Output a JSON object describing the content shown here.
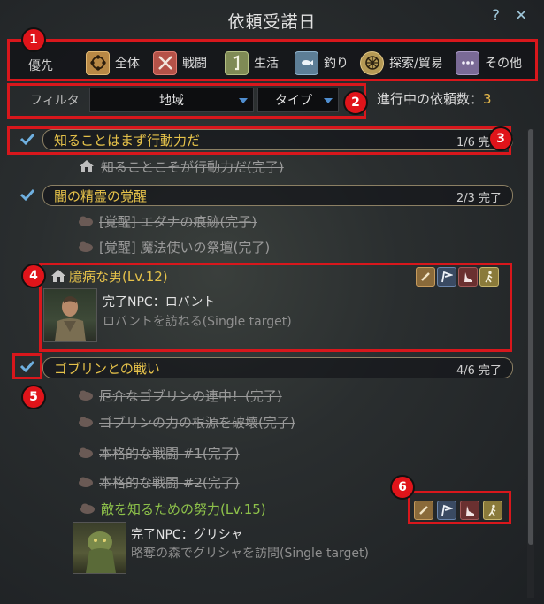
{
  "window": {
    "title": "依頼受諾日",
    "help_label": "?",
    "close_label": "✕"
  },
  "priority": {
    "label": "優先",
    "categories": [
      {
        "label": "全体",
        "icon": "all-icon",
        "color": "#b88845"
      },
      {
        "label": "戦闘",
        "icon": "combat-icon",
        "color": "#b55248"
      },
      {
        "label": "生活",
        "icon": "life-icon",
        "color": "#7f8a55"
      },
      {
        "label": "釣り",
        "icon": "fishing-icon",
        "color": "#5d7e96"
      },
      {
        "label": "探索/貿易",
        "icon": "explore-icon",
        "color": "#b59a55"
      },
      {
        "label": "その他",
        "icon": "misc-icon",
        "color": "#7a6a96"
      }
    ]
  },
  "filter": {
    "label": "フィルタ",
    "region": "地域",
    "type": "タイプ"
  },
  "progress": {
    "label": "進行中の依頼数：",
    "count": "3"
  },
  "quests": {
    "g1": {
      "title": "知ることはまず行動力だ",
      "count": "1/6 完了",
      "items": [
        {
          "text": "知ることこそが行動力だ(完了)"
        }
      ]
    },
    "g2": {
      "title": "闇の精霊の覚醒",
      "count": "2/3 完了",
      "items": [
        {
          "text": "[覚醒] エダナの痕跡(完子)"
        },
        {
          "text": "[覚醒] 魔法使いの祭壇(完了)"
        }
      ]
    },
    "featured1": {
      "title": "臆病な男(Lv.12)",
      "npc": "完了NPC：ロバント",
      "desc": "ロバントを訪ねる(Single target)"
    },
    "g3": {
      "title": "ゴブリンとの戦い",
      "count": "4/6 完了",
      "items": [
        {
          "text": "厄介なゴブリンの連中！(完了)"
        },
        {
          "text": "ゴブリンの力の根源を破壊(完了)"
        },
        {
          "text": "本格的な戦闘 #1(完了)"
        },
        {
          "text": "本格的な戦闘 #2(完了)"
        }
      ]
    },
    "featured2": {
      "title": "敵を知るための努力(Lv.15)",
      "npc": "完了NPC：グリシャ",
      "desc": "略奪の森でグリシャを訪問(Single target)"
    }
  },
  "action_icons": [
    "scroll-icon",
    "flag-icon",
    "boot-icon",
    "walk-icon"
  ],
  "annotations": [
    "1",
    "2",
    "3",
    "4",
    "5",
    "6"
  ]
}
